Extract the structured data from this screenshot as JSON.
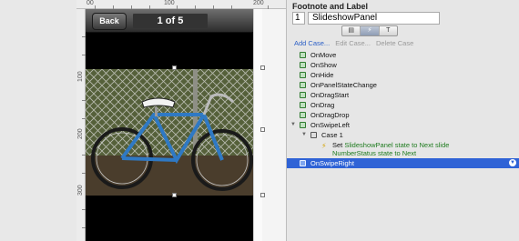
{
  "canvas": {
    "ruler_top_labels": [
      "00",
      "100",
      "200"
    ],
    "ruler_left_labels": [
      "100",
      "200",
      "300"
    ],
    "slideshow": {
      "back_label": "Back",
      "counter_text": "1 of 5"
    }
  },
  "panel": {
    "title": "Footnote and Label",
    "footnote": "1",
    "label": "SlideshowPanel",
    "tabs": [
      "▤",
      "⚡",
      "T"
    ],
    "case_actions": {
      "add": "Add Case...",
      "edit": "Edit Case...",
      "delete": "Delete Case"
    },
    "events": [
      {
        "label": "OnMove"
      },
      {
        "label": "OnShow"
      },
      {
        "label": "OnHide"
      },
      {
        "label": "OnPanelStateChange"
      },
      {
        "label": "OnDragStart"
      },
      {
        "label": "OnDrag"
      },
      {
        "label": "OnDragDrop"
      },
      {
        "label": "OnSwipeLeft"
      }
    ],
    "case": {
      "label": "Case 1",
      "action_line1_prefix": "Set ",
      "action_line1_green": "SlideshowPanel state to Next slide",
      "action_line2": "NumberStatus state to Next"
    },
    "selected_event": "OnSwipeRight"
  },
  "colors": {
    "selection": "#2f63d6",
    "link": "#2b5fc6",
    "action_green": "#1e7b1e"
  }
}
